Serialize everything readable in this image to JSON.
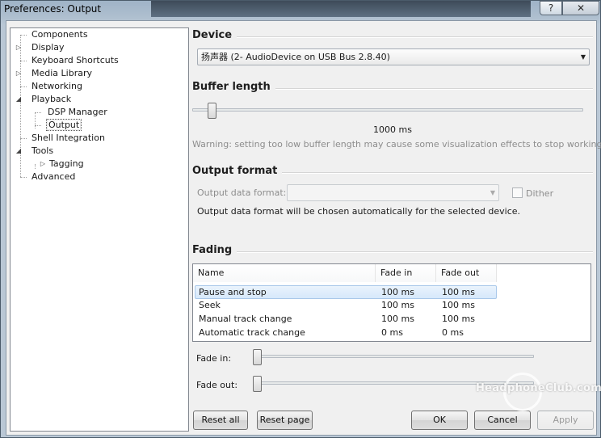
{
  "window": {
    "title": "Preferences: Output",
    "help_label": "?",
    "close_label": "✕"
  },
  "tree": {
    "items": [
      {
        "label": "Components",
        "expander": ""
      },
      {
        "label": "Display",
        "expander": "▷"
      },
      {
        "label": "Keyboard Shortcuts",
        "expander": ""
      },
      {
        "label": "Media Library",
        "expander": "▷"
      },
      {
        "label": "Networking",
        "expander": ""
      },
      {
        "label": "Playback",
        "expander": "◢"
      },
      {
        "label": "DSP Manager",
        "expander": ""
      },
      {
        "label": "Output",
        "expander": "",
        "selected": true
      },
      {
        "label": "Shell Integration",
        "expander": ""
      },
      {
        "label": "Tools",
        "expander": "◢"
      },
      {
        "label": "Tagging",
        "expander": "▷"
      },
      {
        "label": "Advanced",
        "expander": ""
      }
    ]
  },
  "device": {
    "heading": "Device",
    "selected": "扬声器 (2- AudioDevice on USB Bus 2.8.40)"
  },
  "buffer": {
    "heading": "Buffer length",
    "value_text": "1000 ms",
    "slider_fraction": 0.04,
    "warning": "Warning: setting too low buffer length may cause some visualization effects to stop working."
  },
  "output_format": {
    "heading": "Output format",
    "field_label": "Output data format:",
    "selected": "",
    "dither_label": "Dither",
    "dither_checked": false,
    "info": "Output data format will be chosen automatically for the selected device."
  },
  "fading": {
    "heading": "Fading",
    "columns": [
      "Name",
      "Fade in",
      "Fade out"
    ],
    "rows": [
      {
        "name": "Pause and stop",
        "fade_in": "100 ms",
        "fade_out": "100 ms",
        "selected": true
      },
      {
        "name": "Seek",
        "fade_in": "100 ms",
        "fade_out": "100 ms"
      },
      {
        "name": "Manual track change",
        "fade_in": "100 ms",
        "fade_out": "100 ms"
      },
      {
        "name": "Automatic track change",
        "fade_in": "0 ms",
        "fade_out": "0 ms"
      }
    ],
    "fade_in_label": "Fade in:",
    "fade_out_label": "Fade out:",
    "fade_in_fraction": 0.0,
    "fade_out_fraction": 0.0
  },
  "buttons": {
    "reset_all": "Reset all",
    "reset_page": "Reset page",
    "ok": "OK",
    "cancel": "Cancel",
    "apply": "Apply"
  },
  "watermark": {
    "text": "HeadphoneClub.com"
  },
  "colors": {
    "selection": "#d6e8fb",
    "window_frame": "#aebfcf"
  }
}
